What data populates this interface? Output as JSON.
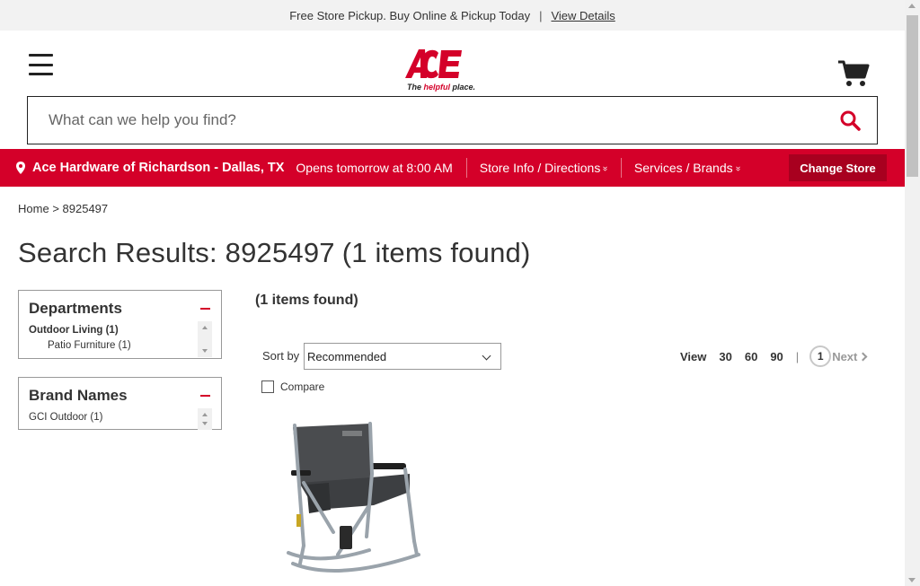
{
  "promo": {
    "text": "Free Store Pickup. Buy Online & Pickup Today",
    "separator": "|",
    "link": "View Details"
  },
  "header": {
    "logo_text": "ACE",
    "logo_tagline": "The helpful place.",
    "menu_icon": "hamburger-menu-icon",
    "cart_icon": "cart-icon"
  },
  "search": {
    "placeholder": "What can we help you find?",
    "value": "",
    "icon": "search-icon"
  },
  "store_bar": {
    "store_name": "Ace Hardware of Richardson - Dallas, TX",
    "hours": "Opens tomorrow at 8:00 AM",
    "store_info_link": "Store Info / Directions",
    "services_link": "Services / Brands",
    "change_store": "Change Store",
    "chevron": "»"
  },
  "breadcrumb": {
    "home": "Home",
    "separator": ">",
    "current": "8925497"
  },
  "results": {
    "title": "Search Results: 8925497",
    "count_text": "(1 items found)",
    "items_found": "(1 items found)"
  },
  "facets": {
    "departments": {
      "title": "Departments",
      "items": [
        {
          "label": "Outdoor Living (1)"
        },
        {
          "label": "Patio Furniture (1)"
        }
      ]
    },
    "brands": {
      "title": "Brand Names",
      "items": [
        {
          "label": "GCI Outdoor (1)"
        }
      ]
    }
  },
  "toolbar": {
    "sort_label": "Sort by",
    "sort_value": "Recommended",
    "compare_label": "Compare",
    "view_label": "View",
    "view_options": [
      "30",
      "60",
      "90"
    ],
    "pipe": "|",
    "current_page": "1",
    "next_label": "Next"
  },
  "colors": {
    "brand_red": "#d40029",
    "dark_red": "#a8001f",
    "text": "#333333"
  }
}
